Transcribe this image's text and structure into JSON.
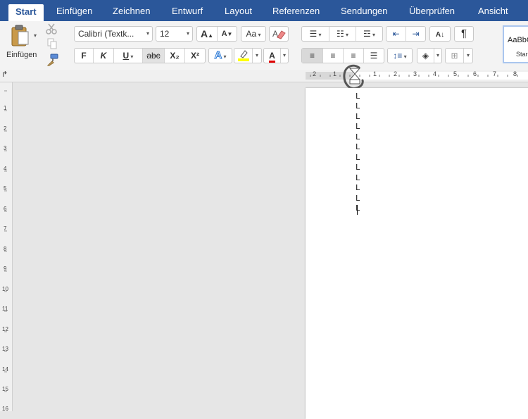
{
  "tabs": [
    "Start",
    "Einfügen",
    "Zeichnen",
    "Entwurf",
    "Layout",
    "Referenzen",
    "Sendungen",
    "Überprüfen",
    "Ansicht"
  ],
  "clipboard": {
    "paste_label": "Einfügen"
  },
  "font": {
    "name": "Calibri (Textk...",
    "size": "12",
    "bold": "F",
    "italic": "K",
    "underline": "U",
    "strike": "abc",
    "subscript": "X₂",
    "superscript": "X²"
  },
  "paragraph": {
    "pilcrow": "¶"
  },
  "styles": {
    "preview": "AaBbC",
    "label": "Star"
  },
  "ruler": {
    "h_numbers": [
      "2",
      "1",
      "1",
      "2",
      "3",
      "4",
      "5",
      "6",
      "7",
      "8"
    ],
    "v_numbers": [
      "1",
      "2",
      "3",
      "4",
      "5",
      "6",
      "7",
      "8",
      "9",
      "10",
      "11",
      "12",
      "13",
      "14",
      "15",
      "16"
    ]
  },
  "document": {
    "lines": [
      "L",
      "L",
      "L",
      "L",
      "L",
      "L",
      "L",
      "L",
      "L",
      "L",
      "L",
      "L"
    ]
  },
  "colors": {
    "tab_bar": "#2b579a",
    "highlight": "#ffff00",
    "font_color": "#e00000",
    "annotation_circle": "#555555"
  }
}
